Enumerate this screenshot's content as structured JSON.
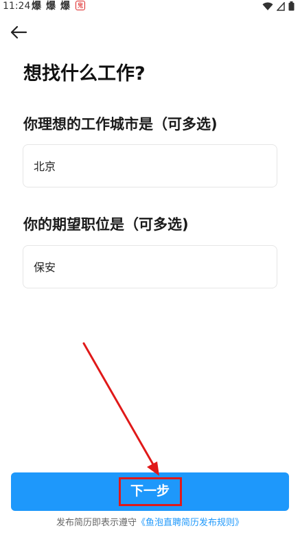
{
  "status_bar": {
    "time": "11:24",
    "notification_glyph": "爆",
    "badge_glyph": "鬼",
    "icons": [
      "wifi-icon",
      "signal-icon",
      "battery-icon"
    ]
  },
  "header": {
    "back_icon": "back-arrow-icon"
  },
  "page": {
    "title": "想找什么工作?"
  },
  "city_section": {
    "label": "你理想的工作城市是（可多选)",
    "value": "北京"
  },
  "position_section": {
    "label": "你的期望职位是（可多选)",
    "value": "保安"
  },
  "actions": {
    "next_label": "下一步"
  },
  "footer": {
    "text": "发布简历即表示遵守",
    "link": "《鱼泡直聘简历发布规则》"
  },
  "colors": {
    "accent": "#1e98fb",
    "highlight": "#e01919"
  }
}
